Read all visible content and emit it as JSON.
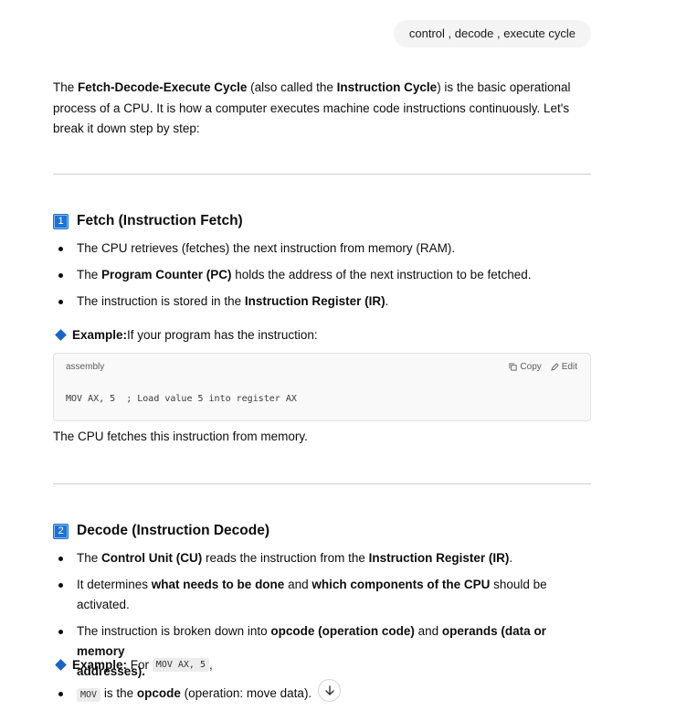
{
  "user_message": "control , decode , execute cycle",
  "intro": {
    "p1": "The ",
    "b1": "Fetch-Decode-Execute Cycle",
    "p2": " (also called the ",
    "b2": "Instruction Cycle",
    "p3": ") is the basic operational process of a CPU. It is how a computer executes machine code instructions continuously. Let's break it down step by step:"
  },
  "sections": [
    {
      "number": "1",
      "title": "Fetch (Instruction Fetch)",
      "bullets": [
        {
          "t1": "The CPU retrieves (fetches) the next instruction from memory (RAM)."
        },
        {
          "t1": "The ",
          "b1": "Program Counter (PC)",
          "t2": " holds the address of the next instruction to be fetched."
        },
        {
          "t1": "The instruction is stored in the ",
          "b1": "Instruction Register (IR)",
          "t2": "."
        }
      ],
      "example_label": "Example:",
      "example_text": " If your program has the instruction:",
      "code": {
        "lang": "assembly",
        "copy_label": "Copy",
        "edit_label": "Edit",
        "content": "MOV AX, 5  ; Load value 5 into register AX"
      },
      "after_code": "The CPU fetches this instruction from memory."
    },
    {
      "number": "2",
      "title": "Decode (Instruction Decode)",
      "bullets": [
        {
          "t1": "The ",
          "b1": "Control Unit (CU)",
          "t2": " reads the instruction from the ",
          "b2": "Instruction Register (IR)",
          "t3": "."
        },
        {
          "t1": "It determines ",
          "b1": "what needs to be done",
          "t2": " and ",
          "b2": "which components of the CPU",
          "t3": " should be activated."
        },
        {
          "t1": "The instruction is broken down into ",
          "b1": "opcode (operation code)",
          "t2": " and ",
          "b2": "operands (data or memory",
          "t3": "",
          "line2": "addresses)."
        }
      ],
      "example_label": "Example:",
      "example_pre": " For ",
      "example_code": "MOV AX, 5",
      "example_post": ",",
      "last_bullet": {
        "code": "MOV",
        "t1": " is the ",
        "b1": "opcode",
        "t2": " (operation: move data)."
      }
    }
  ]
}
